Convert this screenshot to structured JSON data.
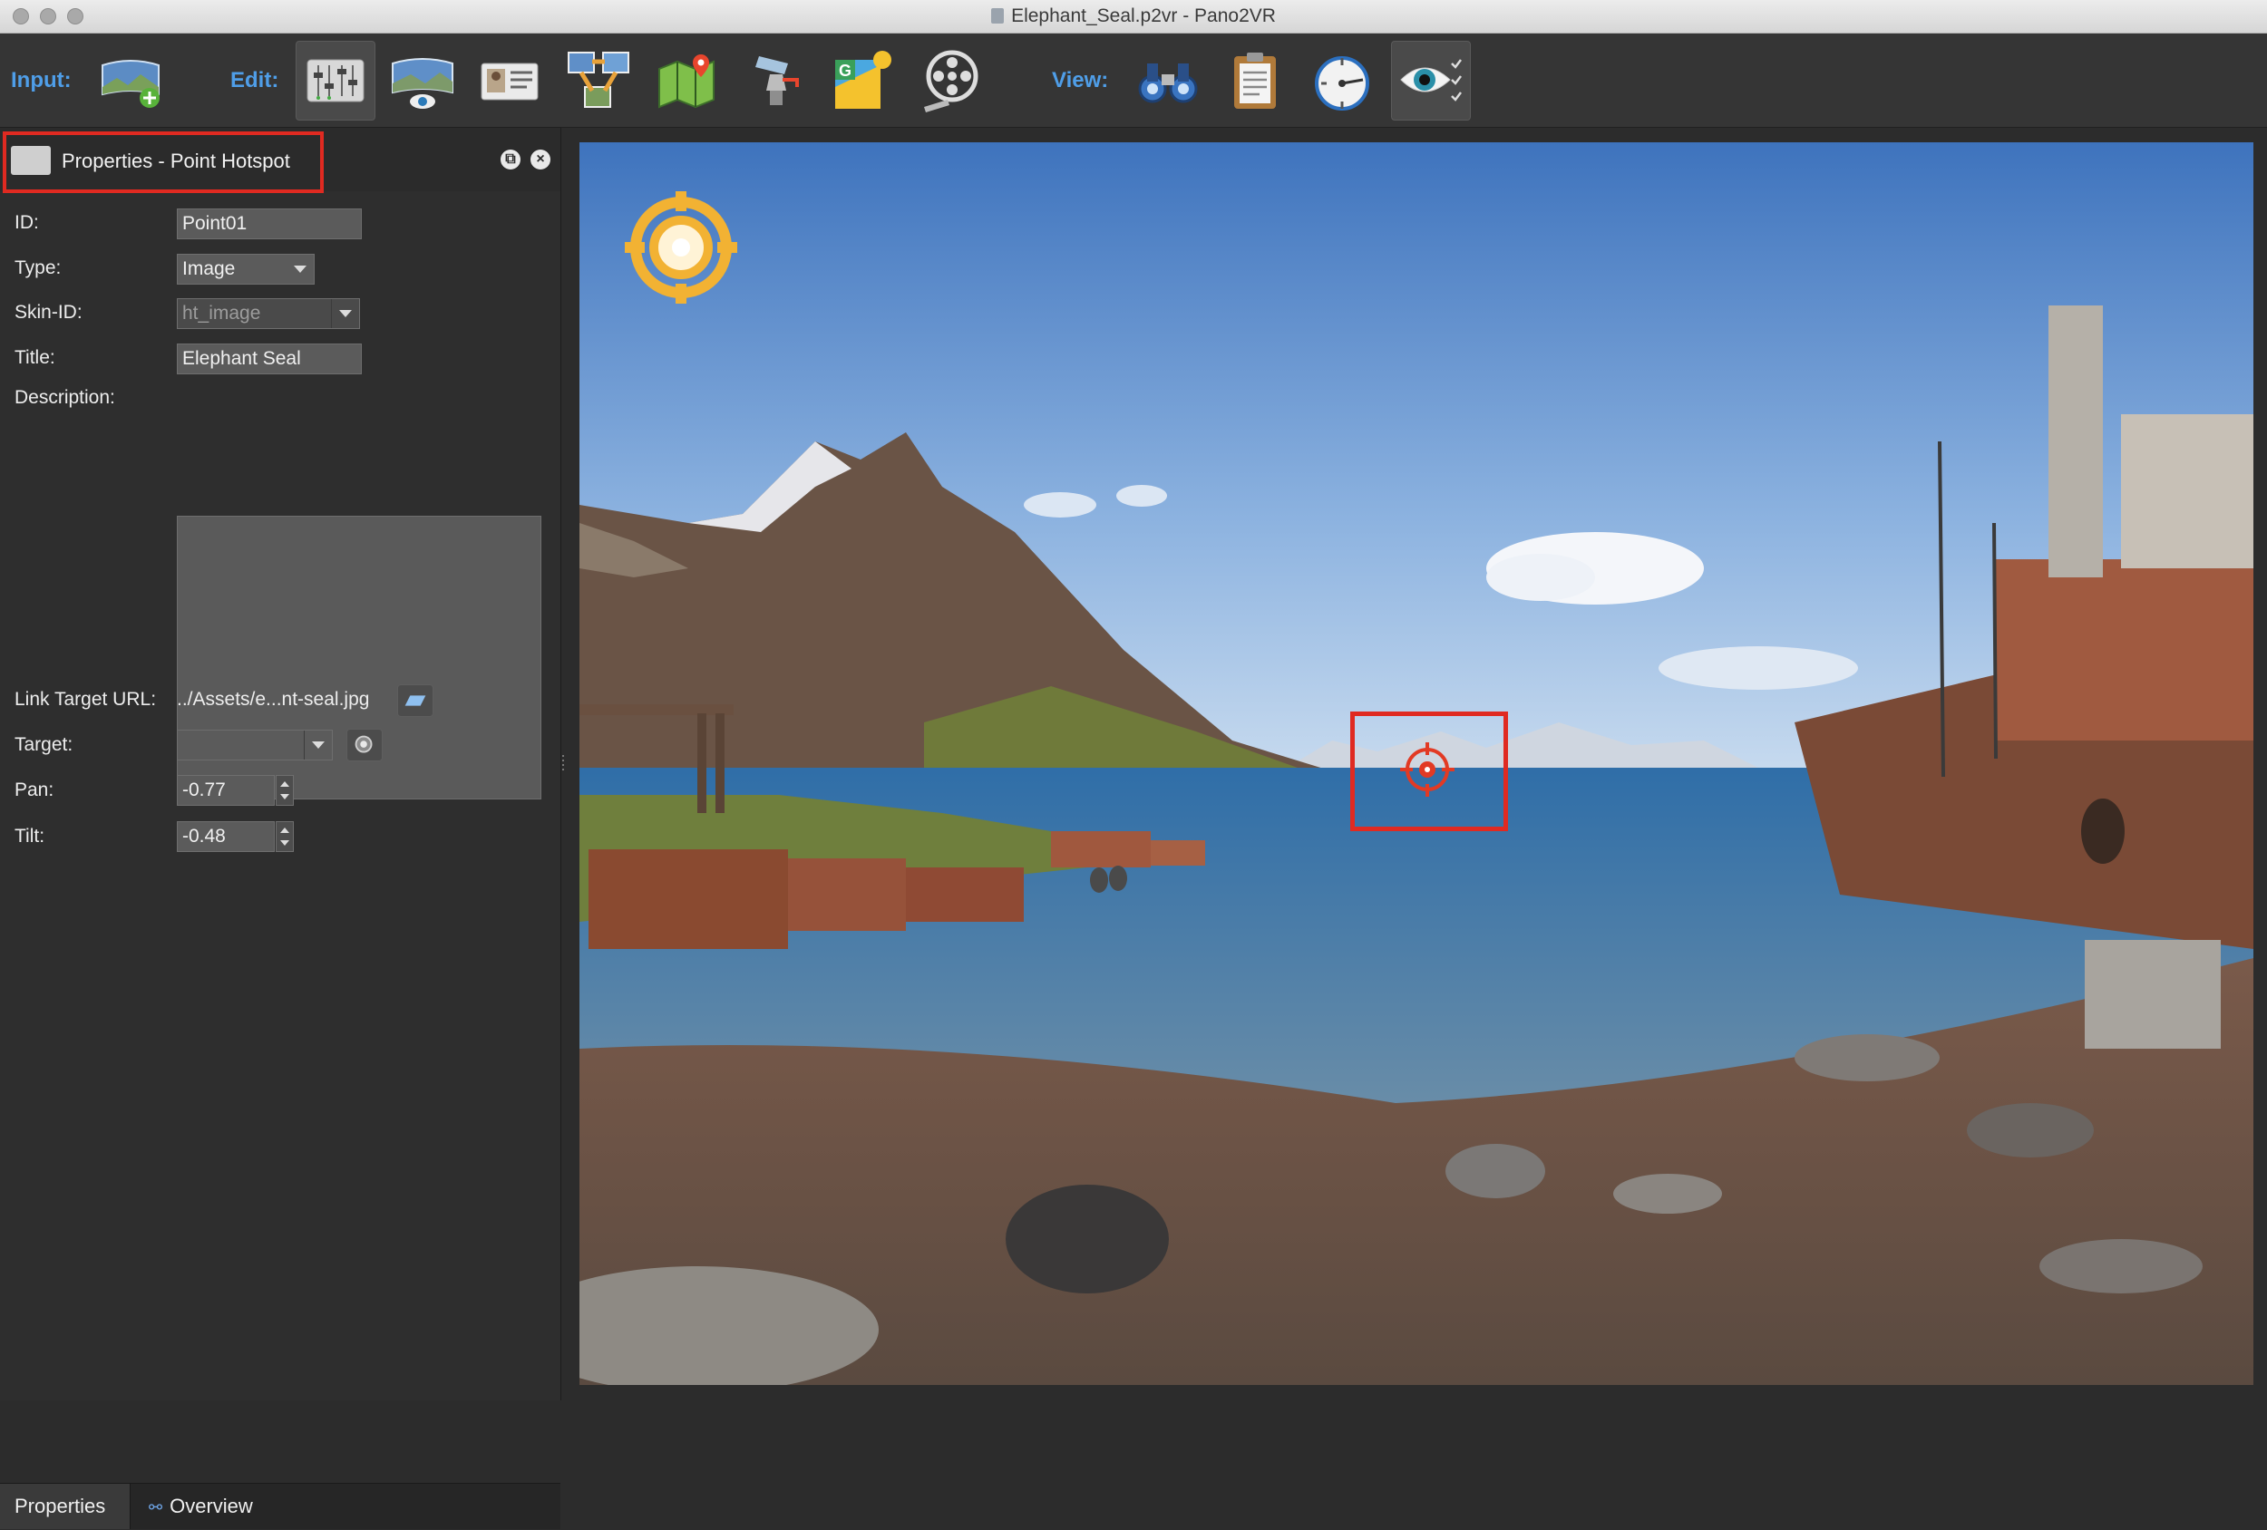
{
  "window": {
    "title": "Elephant_Seal.p2vr - Pano2VR"
  },
  "toolbar": {
    "input_label": "Input:",
    "edit_label": "Edit:",
    "view_label": "View:",
    "buttons": [
      {
        "name": "add-panorama-icon",
        "group": "input"
      },
      {
        "name": "properties-sliders-icon",
        "group": "edit",
        "active": true
      },
      {
        "name": "viewing-parameters-icon",
        "group": "edit"
      },
      {
        "name": "user-data-card-icon",
        "group": "edit"
      },
      {
        "name": "tour-browser-icon",
        "group": "edit"
      },
      {
        "name": "map-icon",
        "group": "edit"
      },
      {
        "name": "patch-input-icon",
        "group": "edit"
      },
      {
        "name": "google-street-view-icon",
        "group": "edit"
      },
      {
        "name": "animation-film-reel-icon",
        "group": "edit"
      },
      {
        "name": "binoculars-icon",
        "group": "view"
      },
      {
        "name": "clipboard-icon",
        "group": "view"
      },
      {
        "name": "compass-tilt-icon",
        "group": "view"
      },
      {
        "name": "eye-visibility-icon",
        "group": "view"
      }
    ]
  },
  "panel": {
    "title": "Properties - Point Hotspot",
    "fields": {
      "id": {
        "label": "ID:",
        "value": "Point01"
      },
      "type": {
        "label": "Type:",
        "value": "Image"
      },
      "skin_id": {
        "label": "Skin-ID:",
        "value": "ht_image"
      },
      "title": {
        "label": "Title:",
        "value": "Elephant Seal"
      },
      "description": {
        "label": "Description:",
        "value": ""
      },
      "link_target_url": {
        "label": "Link Target URL:",
        "value": "../Assets/e...nt-seal.jpg"
      },
      "target": {
        "label": "Target:",
        "value": ""
      },
      "pan": {
        "label": "Pan:",
        "value": "-0.77"
      },
      "tilt": {
        "label": "Tilt:",
        "value": "-0.48"
      }
    },
    "tabs": [
      {
        "label": "Properties",
        "active": true
      },
      {
        "label": "Overview",
        "active": false
      }
    ]
  },
  "colors": {
    "accent": "#4f9ee8",
    "highlight": "#e02a21",
    "hotspot": "#e23a24",
    "nav_icon": "#f2b233"
  }
}
